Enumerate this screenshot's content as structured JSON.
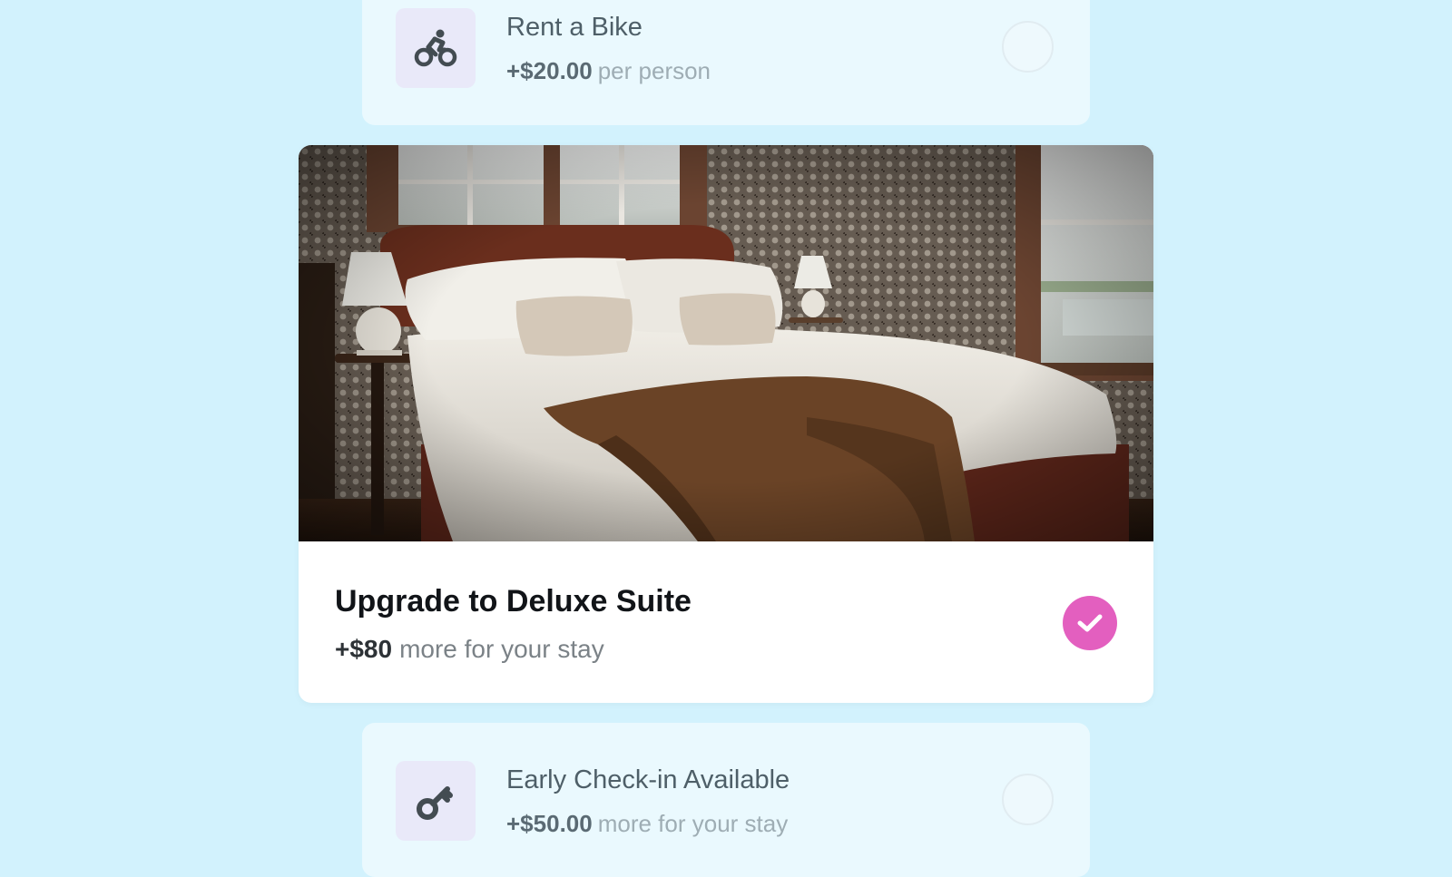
{
  "addons": [
    {
      "title": "Rent a Bike",
      "price": "+$20.00",
      "suffix": "per person",
      "icon": "bike-icon",
      "selected": false
    },
    {
      "title": "Early Check-in Available",
      "price": "+$50.00",
      "suffix": "more for your stay",
      "icon": "key-icon",
      "selected": false
    }
  ],
  "featured": {
    "title": "Upgrade to Deluxe Suite",
    "price": "+$80",
    "suffix": "more for your stay",
    "selected": true,
    "image": "bedroom-photo"
  },
  "colors": {
    "background": "#d2f2fd",
    "addon_card": "#eaf9fe",
    "icon_box": "#e9e9f9",
    "accent": "#e35fbf"
  }
}
